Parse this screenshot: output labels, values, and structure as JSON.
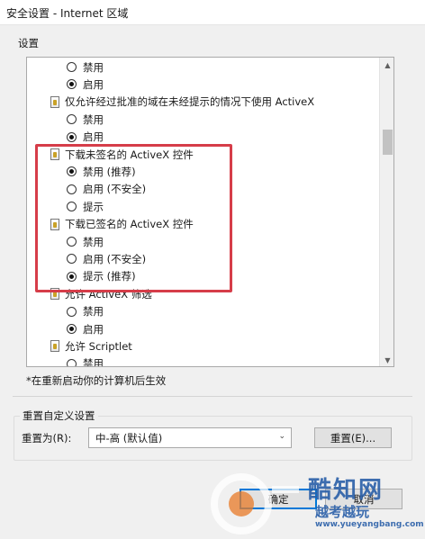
{
  "window": {
    "title": "安全设置 - Internet 区域"
  },
  "settings_group": {
    "label": "设置"
  },
  "list_rows": [
    {
      "kind": "radio",
      "label": "禁用",
      "checked": false
    },
    {
      "kind": "radio",
      "label": "启用",
      "checked": true
    },
    {
      "kind": "header",
      "label": "仅允许经过批准的域在未经提示的情况下使用 ActiveX"
    },
    {
      "kind": "radio",
      "label": "禁用",
      "checked": false
    },
    {
      "kind": "radio",
      "label": "启用",
      "checked": true
    },
    {
      "kind": "header",
      "label": "下载未签名的 ActiveX 控件"
    },
    {
      "kind": "radio",
      "label": "禁用 (推荐)",
      "checked": true
    },
    {
      "kind": "radio",
      "label": "启用 (不安全)",
      "checked": false
    },
    {
      "kind": "radio",
      "label": "提示",
      "checked": false
    },
    {
      "kind": "header",
      "label": "下载已签名的 ActiveX 控件"
    },
    {
      "kind": "radio",
      "label": "禁用",
      "checked": false
    },
    {
      "kind": "radio",
      "label": "启用 (不安全)",
      "checked": false
    },
    {
      "kind": "radio",
      "label": "提示 (推荐)",
      "checked": true
    },
    {
      "kind": "header",
      "label": "允许 ActiveX 筛选"
    },
    {
      "kind": "radio",
      "label": "禁用",
      "checked": false
    },
    {
      "kind": "radio",
      "label": "启用",
      "checked": true
    },
    {
      "kind": "header",
      "label": "允许 Scriptlet"
    },
    {
      "kind": "radio",
      "label": "禁用",
      "checked": false
    }
  ],
  "note": "*在重新启动你的计算机后生效",
  "reset_group": {
    "label": "重置自定义设置",
    "reset_to_label": "重置为(R):",
    "selected_level": "中-高 (默认值)",
    "reset_button": "重置(E)..."
  },
  "footer": {
    "ok_button": "确定",
    "cancel_button": "取消"
  },
  "watermark": {
    "brand": "酷知网",
    "sub": "越考越玩",
    "url": "www.yueyangbang.com"
  },
  "colors": {
    "highlight_border": "#d63d49",
    "watermark": "#2a5fa8"
  }
}
